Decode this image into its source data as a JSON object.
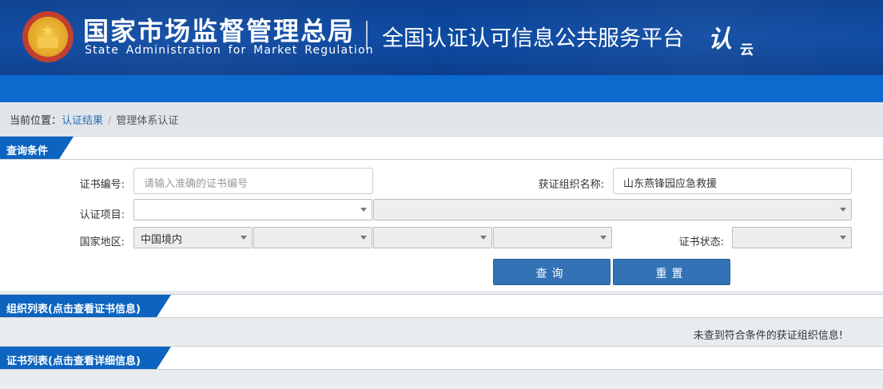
{
  "header": {
    "org_cn": "国家市场监督管理总局",
    "org_en": "State Administration  for  Market Regulation",
    "platform": "全国认证认可信息公共服务平台",
    "logo_main": "认",
    "logo_sub": "云"
  },
  "breadcrumb": {
    "label": "当前位置：",
    "link": "认证结果",
    "separator": "/",
    "current": "管理体系认证"
  },
  "query": {
    "title": "查询条件",
    "cert_no_label": "证书编号:",
    "cert_no_placeholder": "请输入准确的证书编号",
    "org_name_label": "获证组织名称:",
    "org_name_value": "山东燕锋园应急救援",
    "project_label": "认证项目:",
    "region_label": "国家地区:",
    "region_value": "中国境内",
    "status_label": "证书状态:",
    "search_button": "查询",
    "reset_button": "重置"
  },
  "org_list": {
    "title": "组织列表(点击查看证书信息)",
    "empty_message": "未查到符合条件的获证组织信息!"
  },
  "cert_list": {
    "title": "证书列表(点击查看详细信息)"
  },
  "colors": {
    "header_blue": "#0d4aa3",
    "accent_blue": "#0c6acf",
    "button_blue": "#3272b5"
  }
}
